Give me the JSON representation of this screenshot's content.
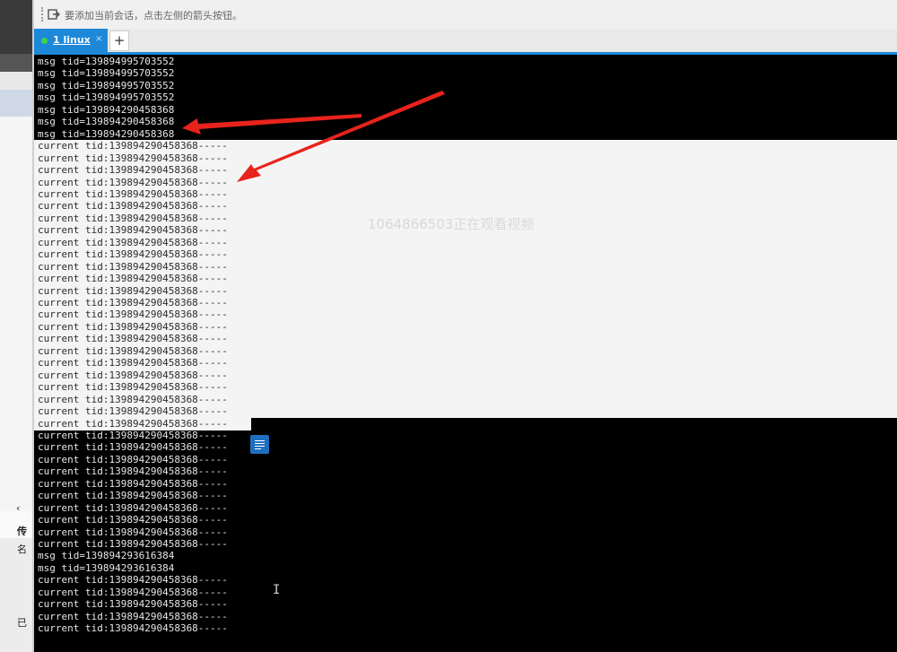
{
  "toolbar": {
    "hint": "要添加当前会话，点击左侧的箭头按钮。"
  },
  "tabs": [
    {
      "label": "1 linux",
      "close": "×",
      "active": true
    }
  ],
  "new_tab_label": "+",
  "sidebar": {
    "partial_labels": [
      "传",
      "名",
      "已"
    ]
  },
  "watermark": "1064866503正在观看视频",
  "terminal": {
    "lines": [
      "msg tid=139894995703552",
      "msg tid=139894995703552",
      "msg tid=139894995703552",
      "msg tid=139894995703552",
      "msg tid=139894290458368",
      "msg tid=139894290458368",
      "msg tid=139894290458368",
      "current tid:139894290458368-----",
      "current tid:139894290458368-----",
      "current tid:139894290458368-----",
      "current tid:139894290458368-----",
      "current tid:139894290458368-----",
      "current tid:139894290458368-----",
      "current tid:139894290458368-----",
      "current tid:139894290458368-----",
      "current tid:139894290458368-----",
      "current tid:139894290458368-----",
      "current tid:139894290458368-----",
      "current tid:139894290458368-----",
      "current tid:139894290458368-----",
      "current tid:139894290458368-----",
      "current tid:139894290458368-----",
      "current tid:139894290458368-----",
      "current tid:139894290458368-----",
      "current tid:139894290458368-----",
      "current tid:139894290458368-----",
      "current tid:139894290458368-----",
      "current tid:139894290458368-----",
      "current tid:139894290458368-----",
      "current tid:139894290458368-----",
      "current tid:139894290458368-----",
      "current tid:139894290458368-----",
      "current tid:139894290458368-----",
      "current tid:139894290458368-----",
      "current tid:139894290458368-----",
      "current tid:139894290458368-----",
      "current tid:139894290458368-----",
      "current tid:139894290458368-----",
      "current tid:139894290458368-----",
      "current tid:139894290458368-----",
      "current tid:139894290458368-----",
      "msg tid=139894293616384",
      "msg tid=139894293616384",
      "current tid:139894290458368-----",
      "current tid:139894290458368-----",
      "current tid:139894290458368-----",
      "current tid:139894290458368-----",
      "current tid:139894290458368-----"
    ],
    "selected_from_index": 7,
    "selected_to_index": 30
  },
  "colors": {
    "terminal_bg": "#000000",
    "terminal_fg": "#e6e6e6",
    "selection_bg": "#f4f4f4",
    "tab_active": "#1e88d8",
    "annotation_arrow": "#e8231c"
  },
  "icons": {
    "toolbar": "send-to-session-icon",
    "float": "notes-icon",
    "cursor": "text-cursor-icon"
  }
}
